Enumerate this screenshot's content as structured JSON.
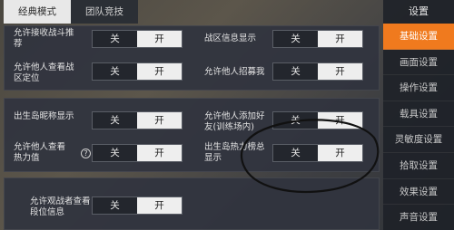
{
  "tabs": [
    {
      "label": "经典模式",
      "active": true
    },
    {
      "label": "团队竞技",
      "active": false
    }
  ],
  "toggle": {
    "off_label": "关",
    "on_label": "开"
  },
  "settings": [
    {
      "label": "允许接收战斗推荐",
      "state": "开"
    },
    {
      "label": "战区信息显示",
      "state": "开"
    },
    {
      "label": "允许他人查看战区定位",
      "state": "开"
    },
    {
      "label": "允许他人招募我",
      "state": "开"
    },
    {
      "label": "出生岛昵称显示",
      "state": "开"
    },
    {
      "label": "允许他人添加好友(训练场内)",
      "state": "开"
    },
    {
      "label": "允许他人查看热力值",
      "state": "开"
    },
    {
      "label": "出生岛热力榜总显示",
      "state": "开"
    },
    {
      "label": "允许观战者查看段位信息",
      "state": "开"
    }
  ],
  "help_icon_glyph": "?",
  "sidebar": {
    "title": "设置",
    "items": [
      {
        "label": "基础设置",
        "active": true
      },
      {
        "label": "画面设置",
        "active": false
      },
      {
        "label": "操作设置",
        "active": false
      },
      {
        "label": "载具设置",
        "active": false
      },
      {
        "label": "灵敏度设置",
        "active": false
      },
      {
        "label": "拾取设置",
        "active": false
      },
      {
        "label": "效果设置",
        "active": false
      },
      {
        "label": "声音设置",
        "active": false
      }
    ]
  },
  "colors": {
    "accent": "#f07a1e",
    "toggle_on": "#eeeeee",
    "toggle_off": "#23262d"
  }
}
